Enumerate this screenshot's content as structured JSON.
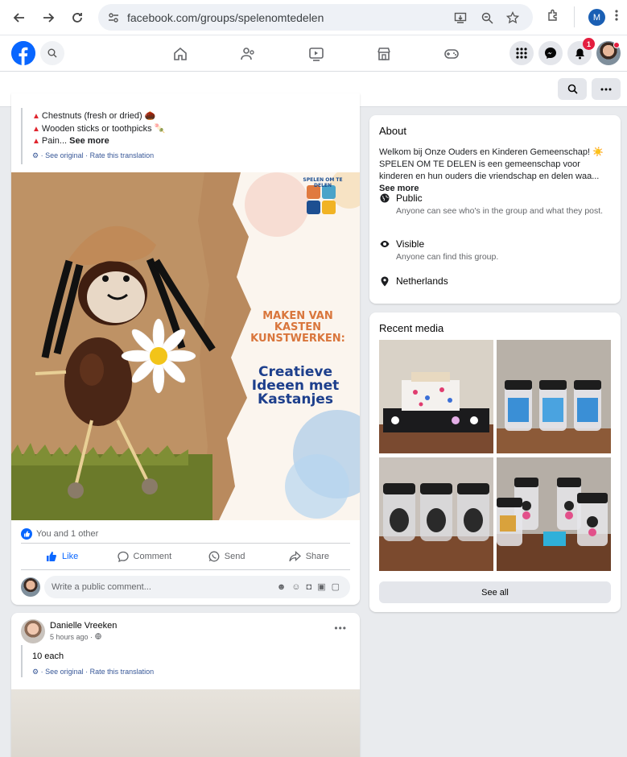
{
  "browser": {
    "url": "facebook.com/groups/spelenomtedelen",
    "profile_initial": "M"
  },
  "facebook": {
    "notification_count": "1"
  },
  "post1": {
    "bullets": [
      "Chestnuts (fresh or dried) 🌰",
      "Wooden sticks or toothpicks 🍡",
      "Pain..."
    ],
    "see_more": "See more",
    "see_original": "See original",
    "rate_translation": "Rate this translation",
    "image": {
      "logo_text": "SPELEN OM TE DELEN",
      "heading": "MAKEN VAN KASTEN KUNSTWERKEN:",
      "subheading": "Creatieve Ideeen met Kastanjes"
    },
    "reactions": "You and 1 other",
    "actions": {
      "like": "Like",
      "comment": "Comment",
      "send": "Send",
      "share": "Share"
    },
    "comment_placeholder": "Write a public comment..."
  },
  "post2": {
    "author": "Danielle Vreeken",
    "time": "5 hours ago ·",
    "text": "10 each",
    "see_original": "See original",
    "rate_translation": "Rate this translation"
  },
  "about": {
    "title": "About",
    "description": "Welkom bij Onze Ouders en Kinderen Gemeenschap! ☀️ SPELEN OM TE DELEN is een gemeenschap voor kinderen en hun ouders die vriendschap en delen waa...",
    "see_more": "See more",
    "public_title": "Public",
    "public_desc": "Anyone can see who's in the group and what they post.",
    "visible_title": "Visible",
    "visible_desc": "Anyone can find this group.",
    "location": "Netherlands"
  },
  "recent_media": {
    "title": "Recent media",
    "see_all": "See all"
  },
  "colors": {
    "facebook_blue": "#0866ff",
    "background": "#e9ebee"
  }
}
